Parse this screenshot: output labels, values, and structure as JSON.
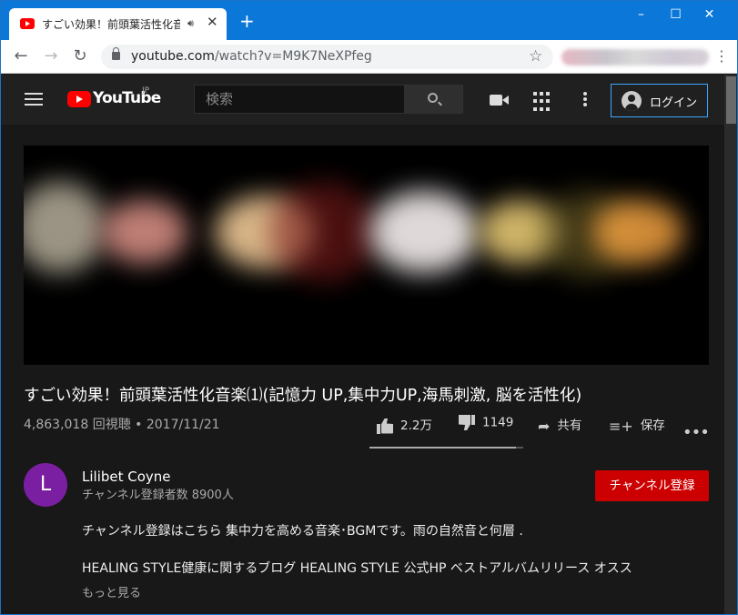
{
  "browser": {
    "tab_title": "すごい効果！前頭葉活性化音楽",
    "new_tab": "+",
    "url_host": "youtube.com",
    "url_path": "/watch?v=M9K7NeXPfeg",
    "window_controls": [
      "–",
      "☐",
      "✕"
    ]
  },
  "header": {
    "logo_text": "YouTube",
    "region": "JP",
    "search_placeholder": "検索",
    "signin_label": "ログイン"
  },
  "video": {
    "title": "すごい効果！前頭葉活性化音楽⑴(記憶力 UP,集中力UP,海馬刺激, 脳を活性化)",
    "views_date": "4,863,018 回視聴 • 2017/11/21",
    "likes": "2.2万",
    "dislikes": "1149",
    "share_label": "共有",
    "save_label": "保存",
    "like_ratio": 0.95
  },
  "channel": {
    "avatar_letter": "L",
    "name": "Lilibet Coyne",
    "subscribers": "チャンネル登録者数 8900人",
    "subscribe_label": "チャンネル登録",
    "avatar_color": "#7b1fa2"
  },
  "description": {
    "line1": "チャンネル登録はこちら 集中力を高める音楽･BGMです。雨の自然音と何層 .",
    "line2": "HEALING STYLE健康に関するブログ HEALING STYLE 公式HP ベストアルバムリリース オスス",
    "show_more": "もっと見る"
  },
  "colors": {
    "accent_red": "#cc0000",
    "link_blue": "#3ea6ff",
    "browser_blue": "#0a77d9"
  }
}
